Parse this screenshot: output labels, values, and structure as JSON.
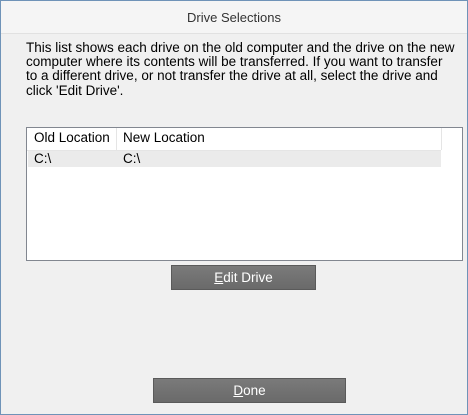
{
  "window": {
    "title": "Drive Selections"
  },
  "instructions": "This list shows each drive on the old computer and the drive on the new computer where its contents will be transferred. If you want to transfer to a different drive, or not transfer the drive at all, select the drive and click 'Edit Drive'.",
  "drive_list": {
    "columns": [
      "Old Location",
      "New Location"
    ],
    "rows": [
      {
        "old": "C:\\",
        "new": "C:\\"
      }
    ]
  },
  "buttons": {
    "edit_drive": {
      "mnemonic": "E",
      "rest": "dit Drive"
    },
    "done": {
      "mnemonic": "D",
      "rest": "one"
    }
  }
}
